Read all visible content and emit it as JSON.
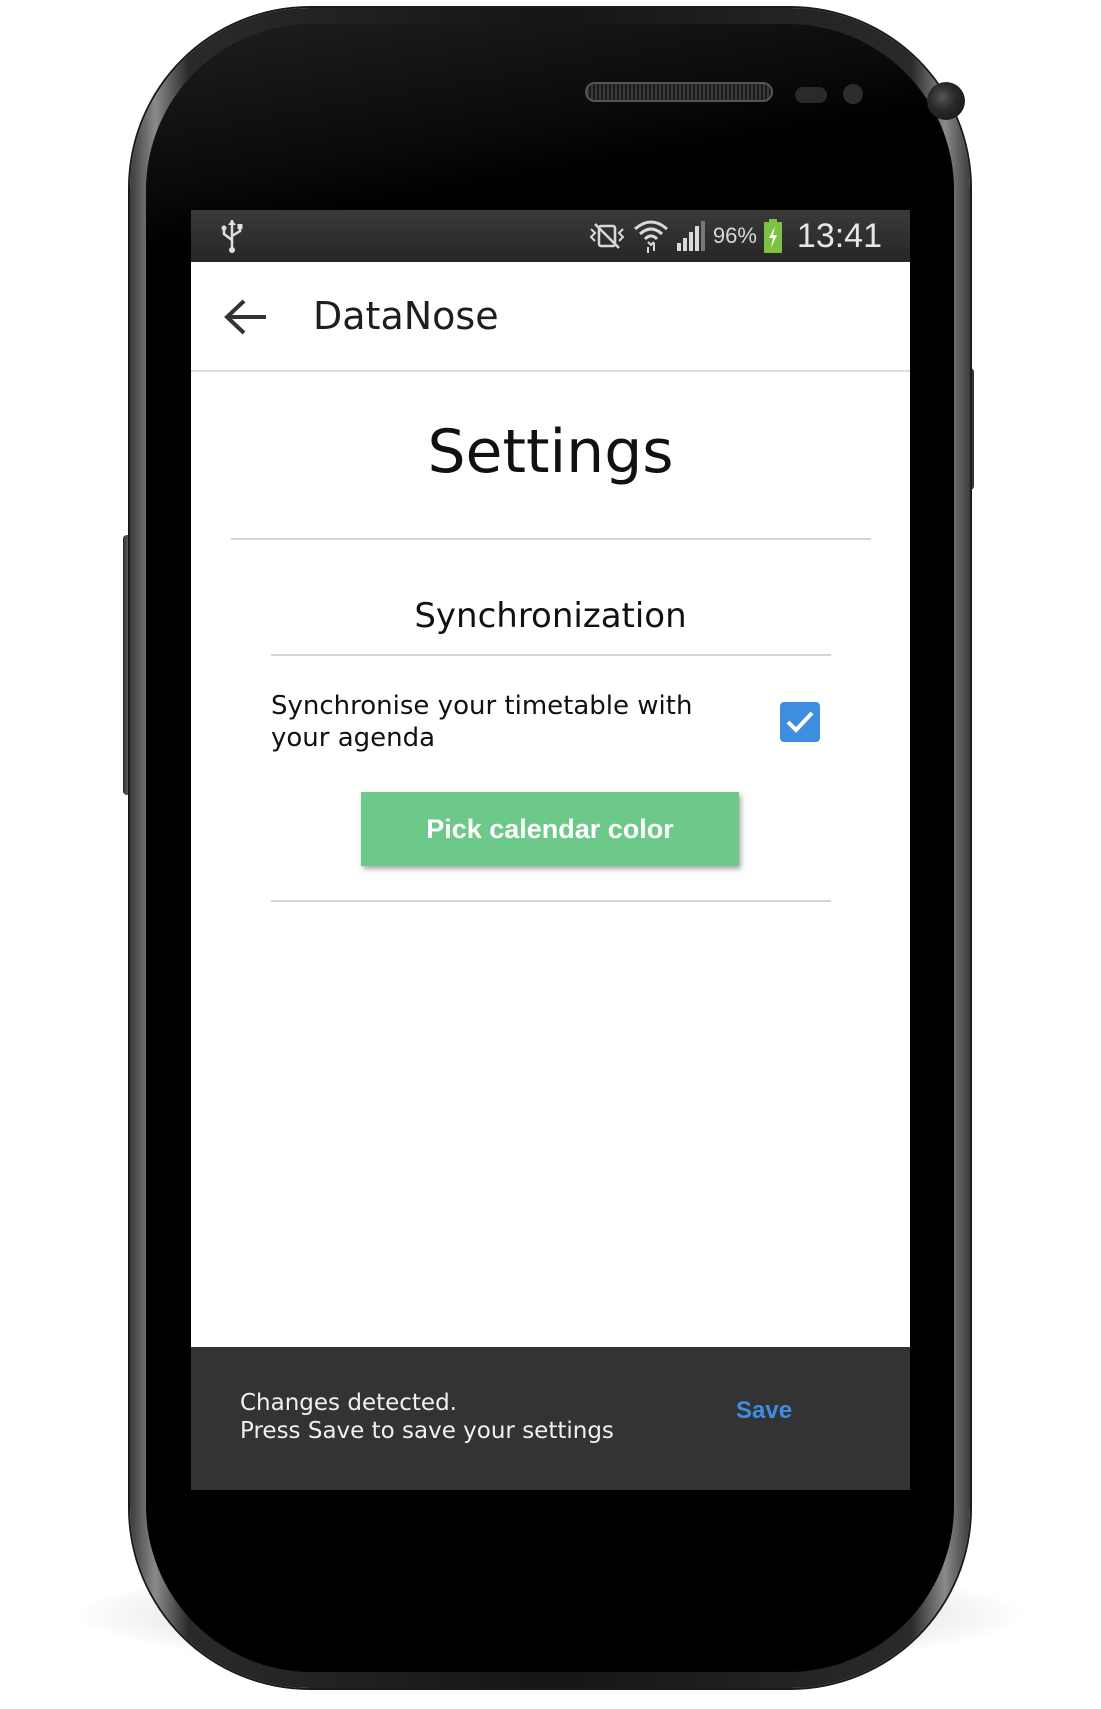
{
  "status_bar": {
    "battery_percent": "96%",
    "time": "13:41",
    "icons": [
      "usb-icon",
      "no-vibrate-icon",
      "wifi-icon",
      "signal-icon",
      "battery-charging-icon"
    ]
  },
  "app_bar": {
    "back_icon": "arrow-left-icon",
    "title": "DataNose"
  },
  "settings": {
    "title": "Settings",
    "section_title": "Synchronization",
    "sync_label": "Synchronise your timetable with your agenda",
    "sync_checked": true,
    "pick_color_label": "Pick calendar color"
  },
  "snackbar": {
    "line1": "Changes detected.",
    "line2": "Press Save to save your settings",
    "save_label": "Save"
  },
  "colors": {
    "accent_blue": "#3d8de0",
    "button_green": "#6cc98a",
    "snackbar_bg": "#333333",
    "battery_green": "#7dc242"
  }
}
